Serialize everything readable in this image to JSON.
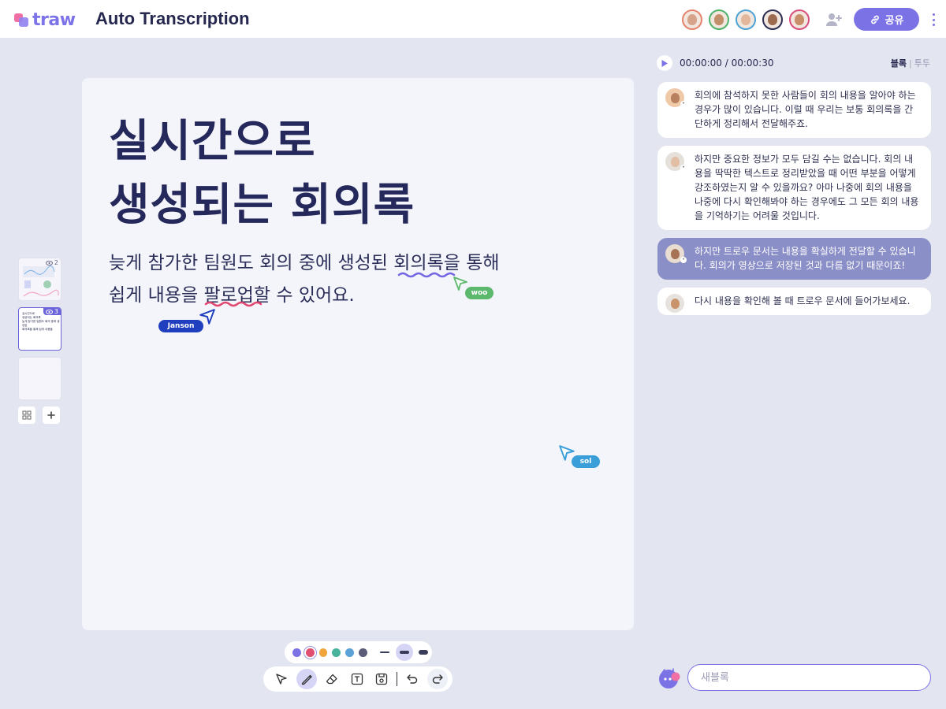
{
  "header": {
    "logo_text": "traw",
    "app_title": "Auto Transcription",
    "share_label": "공유",
    "participants": [
      {
        "ring": "#e5846e",
        "skin": "#d7a28a"
      },
      {
        "ring": "#4fb26b",
        "skin": "#c28f6b"
      },
      {
        "ring": "#4ea2d6",
        "skin": "#e2b79b"
      },
      {
        "ring": "#2d2f55",
        "skin": "#9b6a4f"
      },
      {
        "ring": "#d84f7d",
        "skin": "#c98e6a"
      }
    ]
  },
  "pages": [
    {
      "views": "2"
    },
    {
      "views": "3",
      "mini_text": "실시간으로\n생성되는 회의록\n늦게 참가한 팀원도 회의 중에 생성된\n회의록을 통해 쉽게 내용을"
    },
    {
      "views": ""
    }
  ],
  "canvas": {
    "heading_line1": "실시간으로",
    "heading_line2": "생성되는 회의록",
    "body_line1_a": "늦게 참가한 팀원도 회의 중에 생성된 ",
    "body_line1_b": "회의록",
    "body_line1_c": "을 통해",
    "body_line2_a": "쉽게 내용을 ",
    "body_line2_b": "팔로업",
    "body_line2_c": "할 수 있어요.",
    "cursors": [
      {
        "name": "woo",
        "color": "#5cb86c"
      },
      {
        "name": "Janson",
        "color": "#1f3fbf"
      },
      {
        "name": "sol",
        "color": "#3a9fd8"
      }
    ]
  },
  "colors": {
    "accent": "#7b72e6",
    "palette": [
      "#7b72e6",
      "#e04f6f",
      "#f0a43a",
      "#47b39b",
      "#5aa2d8",
      "#5b5d78"
    ]
  },
  "player": {
    "time": "00:00:00 / 00:00:30",
    "view_block": "블록",
    "view_todo": "투두"
  },
  "transcript": [
    {
      "text": "회의에 참석하지 못한 사람들이 회의 내용을 알아야 하는 경우가 많이 있습니다. 이럴 때 우리는 보통 회의록을 간단하게 정리해서 전달해주죠.",
      "skin": "#b98060",
      "bg": "#f0c9a8"
    },
    {
      "text": "하지만 중요한 정보가 모두 담길 수는 없습니다. 회의 내용을 딱딱한 텍스트로 정리받았을 때 어떤 부분을 어떻게 강조하였는지 알 수 있을까요? 아마 나중에 회의 내용을 나중에 다시 확인해봐야 하는 경우에도 그 모든 회의 내용을 기억하기는 어려울 것입니다.",
      "skin": "#e2bfa4",
      "bg": "#e6e0da"
    },
    {
      "text": "하지만 트로우 문서는 내용을 확실하게 전달할 수 있습니다. 회의가 영상으로 저장된 것과 다름 없기 때문이죠!",
      "skin": "#a77356",
      "bg": "#e9ddd2"
    },
    {
      "text": "다시 내용을 확인해 볼 때 트로우 문서에 들어가보세요.",
      "skin": "#c9946c",
      "bg": "#e6e3de"
    }
  ],
  "new_block": {
    "placeholder": "새블록"
  }
}
